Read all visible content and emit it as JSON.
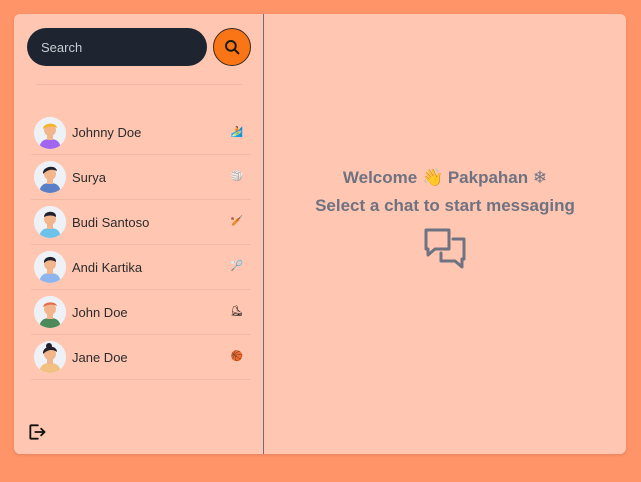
{
  "search": {
    "placeholder": "Search",
    "button_icon": "search-icon"
  },
  "conversations": [
    {
      "name": "Johnny Doe",
      "emoji": "🏄",
      "avatar": {
        "skin": "#f2b58c",
        "hair": "#f5b52a",
        "shirt": "#a066f0"
      }
    },
    {
      "name": "Surya",
      "emoji": "🏐",
      "avatar": {
        "skin": "#f2b58c",
        "hair": "#1f1f2e",
        "shirt": "#5b7fc6"
      }
    },
    {
      "name": "Budi Santoso",
      "emoji": "🏏",
      "avatar": {
        "skin": "#f2b58c",
        "hair": "#1f1f2e",
        "shirt": "#6cc2e8"
      }
    },
    {
      "name": "Andi Kartika",
      "emoji": "🏸",
      "avatar": {
        "skin": "#f2b58c",
        "hair": "#1f1f2e",
        "shirt": "#8fb5ef"
      }
    },
    {
      "name": "John Doe",
      "emoji": "⛸",
      "avatar": {
        "skin": "#f2b58c",
        "hair": "#e36f4a",
        "shirt": "#4d8a5a"
      }
    },
    {
      "name": "Jane Doe",
      "emoji": "🏀",
      "avatar": {
        "skin": "#f2b58c",
        "hair": "#1f1f2e",
        "shirt": "#f2c080"
      }
    }
  ],
  "main": {
    "welcome": "Welcome 👋 Pakpahan ❄",
    "subtitle": "Select a chat to start messaging",
    "icon": "chat-bubbles-icon"
  },
  "logout": {
    "icon": "logout-icon"
  },
  "colors": {
    "background": "#ff9469",
    "panel": "#ffc7b2",
    "search_bg": "#1e2530",
    "accent": "#f97516",
    "muted_text": "#6e7281"
  }
}
